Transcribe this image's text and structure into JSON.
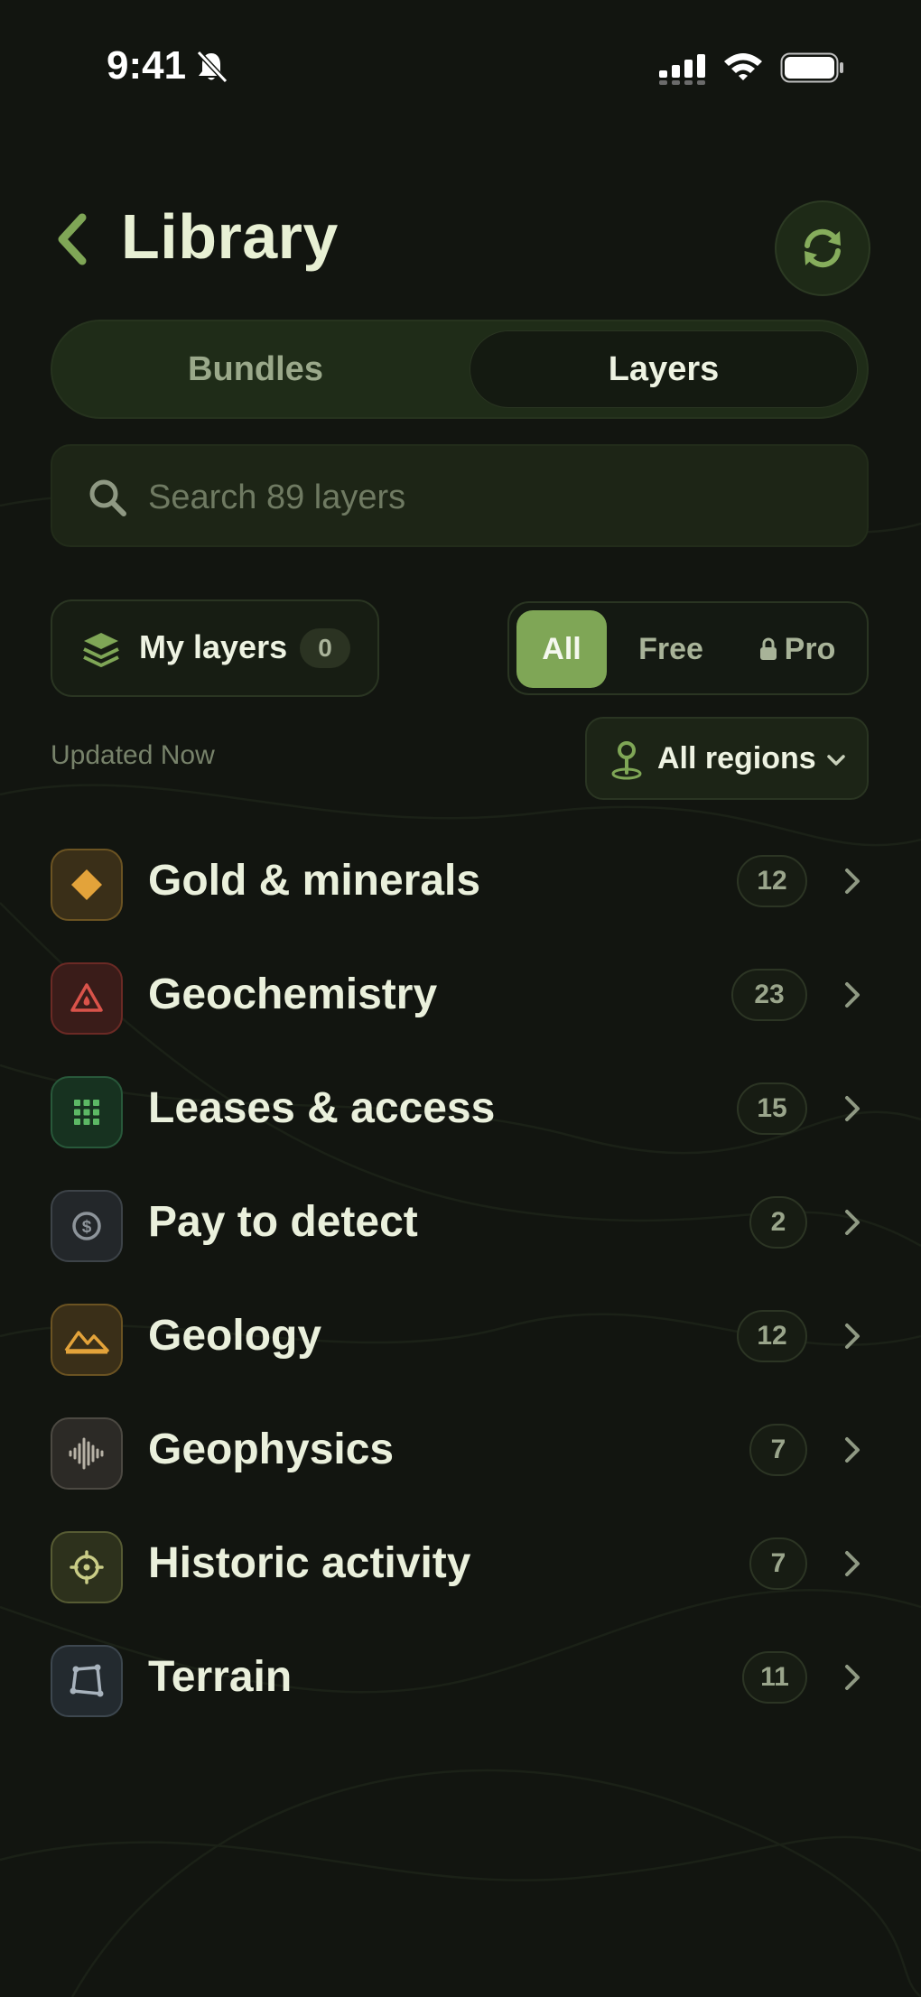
{
  "status_bar": {
    "time": "9:41"
  },
  "header": {
    "title": "Library"
  },
  "segments": {
    "bundles": "Bundles",
    "layers": "Layers"
  },
  "search": {
    "placeholder": "Search 89 layers"
  },
  "my_layers": {
    "label": "My layers",
    "count": "0"
  },
  "tiers": {
    "all": "All",
    "free": "Free",
    "pro": "Pro",
    "selected": "All"
  },
  "updated": "Updated Now",
  "regions": {
    "label": "All regions"
  },
  "categories": [
    {
      "label": "Gold & minerals",
      "count": "12",
      "icon": "diamond-icon",
      "color": "#e3a33a"
    },
    {
      "label": "Geochemistry",
      "count": "23",
      "icon": "flask-warning-icon",
      "color": "#d9534a"
    },
    {
      "label": "Leases & access",
      "count": "15",
      "icon": "grid-icon",
      "color": "#5cb865"
    },
    {
      "label": "Pay to detect",
      "count": "2",
      "icon": "dollar-coin-icon",
      "color": "#8d949a"
    },
    {
      "label": "Geology",
      "count": "12",
      "icon": "mountains-icon",
      "color": "#e3a33a"
    },
    {
      "label": "Geophysics",
      "count": "7",
      "icon": "waveform-icon",
      "color": "#b7b2a6"
    },
    {
      "label": "Historic activity",
      "count": "7",
      "icon": "crosshair-icon",
      "color": "#c9cc86"
    },
    {
      "label": "Terrain",
      "count": "11",
      "icon": "polygon-icon",
      "color": "#a8b3bd"
    }
  ],
  "colors": {
    "accent": "#7fa656",
    "background": "#121510",
    "text": "#eaf0dc"
  }
}
